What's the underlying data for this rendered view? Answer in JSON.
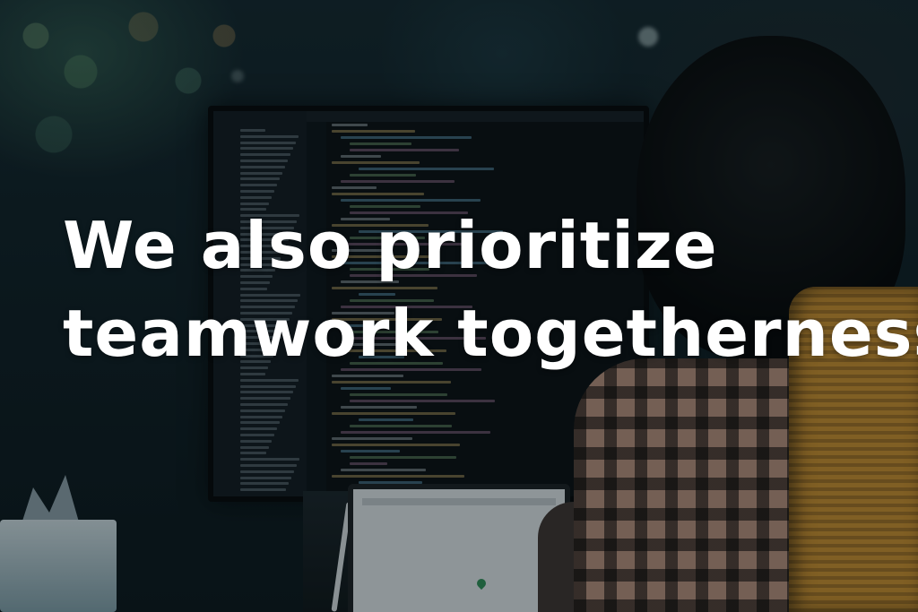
{
  "caption": {
    "line1": "We also prioritize",
    "line2": "teamwork togetherness"
  },
  "colors": {
    "caption_text": "#ffffff",
    "background_tint": "#0d1a20",
    "chair_accent": "#c28a2e"
  }
}
